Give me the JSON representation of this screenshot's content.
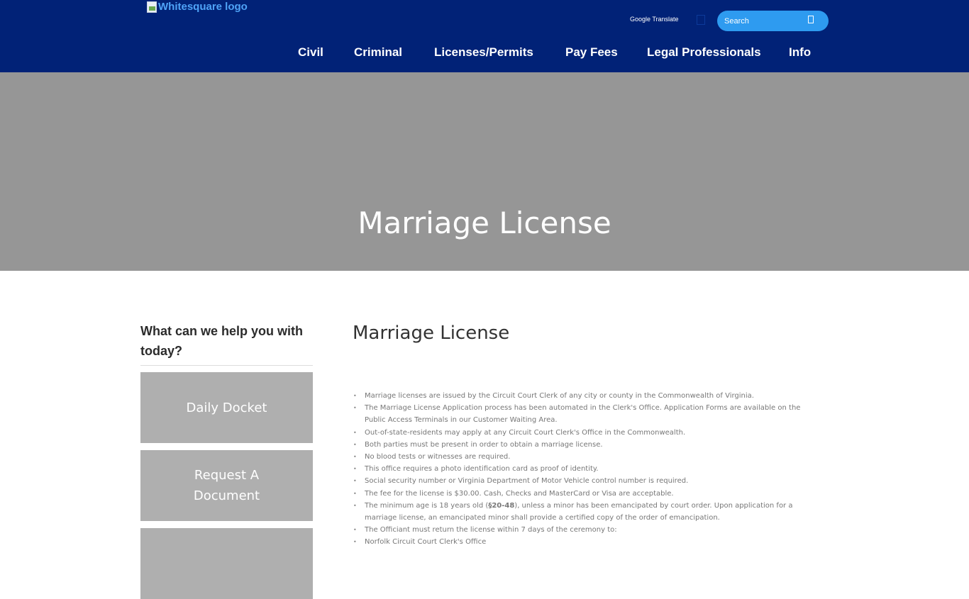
{
  "header": {
    "logo_alt": "Whitesquare logo",
    "translate_label": "Google Translate",
    "search_placeholder": "Search",
    "nav": [
      "Civil",
      "Criminal",
      "Licenses/Permits",
      "Pay Fees",
      "Legal Professionals",
      "Info"
    ]
  },
  "hero": {
    "title": "Marriage License"
  },
  "sidebar": {
    "title": "What can we help you with today?",
    "buttons": [
      "Daily Docket",
      "Request A Document",
      ""
    ]
  },
  "content": {
    "title": "Marriage License",
    "items": [
      "Marriage licenses are issued by the Circuit Court Clerk of any city or county in the Commonwealth of Virginia.",
      "The Marriage License Application process has been automated in the Clerk's Office. Application Forms are available on the Public Access Terminals in our Customer Waiting Area.",
      "Out-of-state-residents may apply at any Circuit Court Clerk's Office in the Commonwealth.",
      "Both parties must be present in order to obtain a marriage license.",
      "No blood tests or witnesses are required.",
      "This office requires a photo identification card as proof of identity.",
      "Social security number or Virginia Department of Motor Vehicle control number is required.",
      "The fee for the license is $30.00. Cash, Checks and MasterCard or Visa are acceptable.",
      "The Officiant must return the license within 7 days of the ceremony to:",
      "Norfolk Circuit Court Clerk's Office"
    ],
    "age_item": {
      "before": "The minimum age is 18 years old (",
      "code": "§20-48",
      "after": "), unless a minor has been emancipated by court order. Upon application for a marriage license, an emancipated minor shall provide a certified copy of the order of emancipation."
    }
  },
  "colors": {
    "header_bg": "#012277",
    "search_bg": "#2e9bf0",
    "hero_bg": "#969696",
    "sidebar_button_bg": "#afafaf"
  }
}
